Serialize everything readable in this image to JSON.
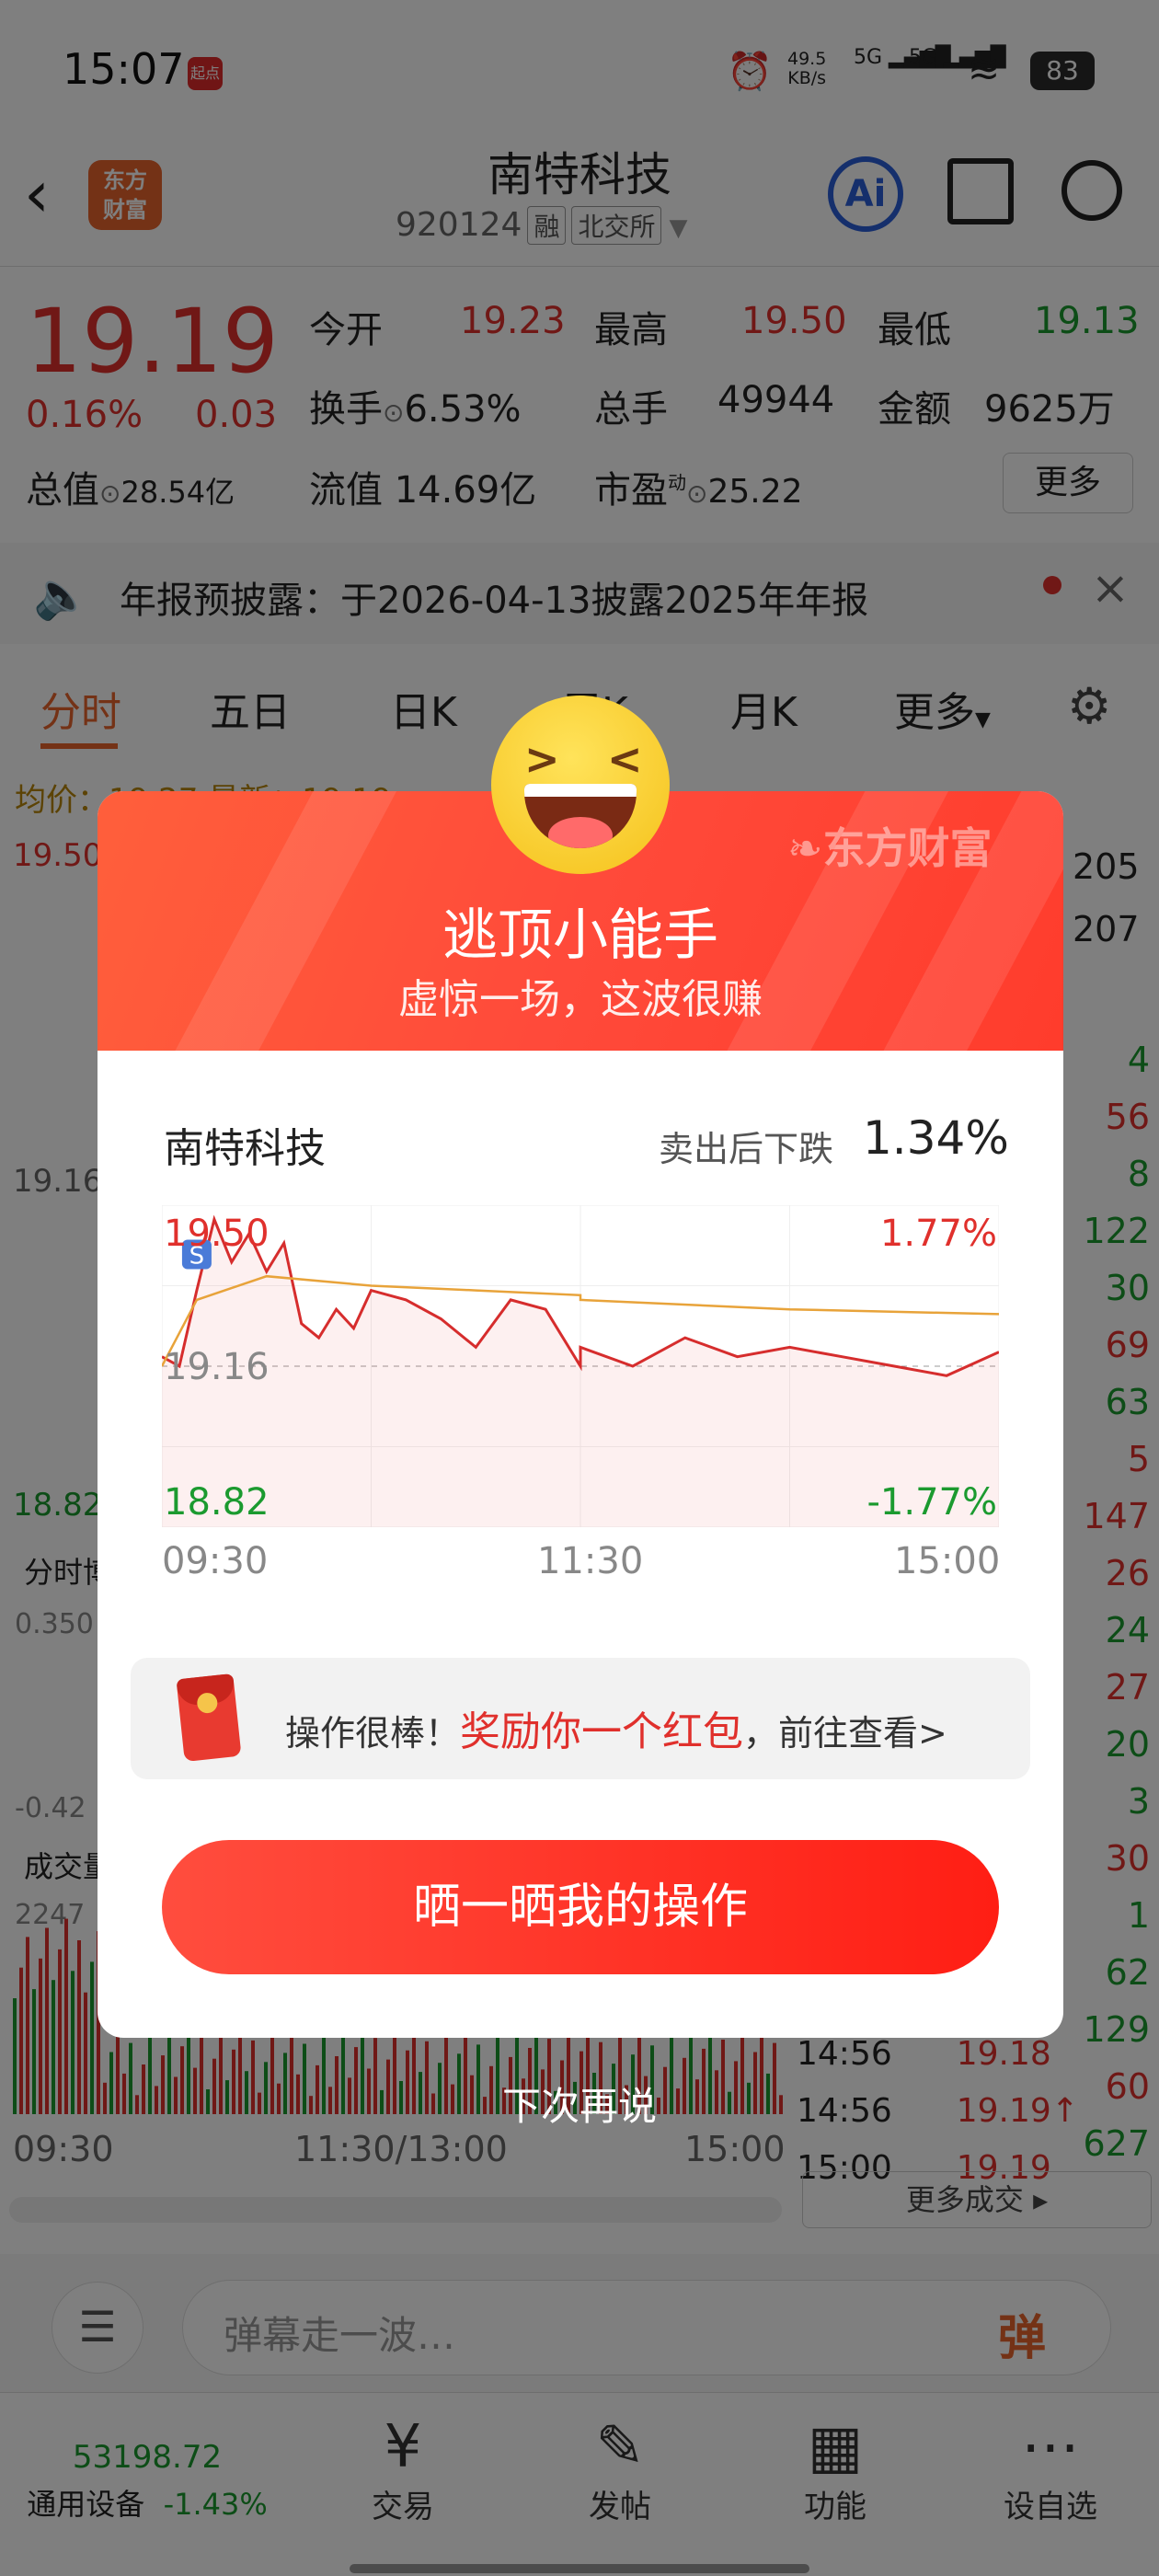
{
  "status_bar": {
    "time": "15:07",
    "badge": "起点",
    "net_speed_value": "49.5",
    "net_speed_unit": "KB/s",
    "sim1": "5G",
    "sim2": "5G",
    "battery": "83"
  },
  "header": {
    "logo_text_1": "东方",
    "logo_text_2": "财富",
    "stock_name": "南特科技",
    "stock_code": "920124",
    "tag_margin": "融",
    "tag_exchange": "北交所",
    "ai_label": "Ai"
  },
  "quote": {
    "price": "19.19",
    "change_pct": "0.16%",
    "change_amt": "0.03",
    "market_cap_label": "总值",
    "market_cap": "28.54亿",
    "open_label": "今开",
    "open": "19.23",
    "high_label": "最高",
    "high": "19.50",
    "low_label": "最低",
    "low": "19.13",
    "turnover_label": "换手",
    "turnover": "6.53%",
    "volume_label": "总手",
    "volume": "49944",
    "amount_label": "金额",
    "amount": "9625万",
    "float_cap_label": "流值",
    "float_cap": "14.69亿",
    "pe_label": "市盈",
    "pe_sup": "动",
    "pe": "25.22",
    "more_button": "更多"
  },
  "notice": {
    "text": "年报预披露：于2026-04-13披露2025年年报"
  },
  "tabs": [
    "分时",
    "五日",
    "日K",
    "周K",
    "月K",
    "更多"
  ],
  "chart_bg": {
    "avg_label": "均价：",
    "avg_value": "19.27",
    "latest_label": "最新：",
    "latest_value": "19.19",
    "y_top": "19.50",
    "y_mid": "19.16",
    "y_bottom": "18.82",
    "sub_label": "分时博",
    "sub_top": "0.350",
    "sub_bottom": "-0.42",
    "vol_label": "成交量",
    "vol_top": "2247",
    "x_start": "09:30",
    "x_mid": "11:30/13:00",
    "x_end": "15:00"
  },
  "right_panel": {
    "top_values": [
      "205",
      "207"
    ],
    "trade_volumes": [
      "4",
      "56",
      "8",
      "122",
      "30",
      "69",
      "63",
      "5",
      "147",
      "26",
      "24",
      "27",
      "20",
      "3",
      "30",
      "1",
      "62",
      "129",
      "60",
      "627"
    ],
    "rows": [
      {
        "time": "14:56",
        "price": "19.18",
        "vol": "129"
      },
      {
        "time": "14:56",
        "price": "19.19↑",
        "vol": "60"
      },
      {
        "time": "15:00",
        "price": "19.19",
        "vol": "627"
      }
    ],
    "more_trades": "更多成交"
  },
  "popup": {
    "brand": "东方财富",
    "title": "逃顶小能手",
    "subtitle": "虚惊一场，这波很赚",
    "stock_name": "南特科技",
    "drop_label": "卖出后下跌",
    "drop_value": "1.34%",
    "reward_prefix": "操作很棒！",
    "reward_highlight": "奖励你一个红包",
    "reward_suffix": "，前往查看>",
    "cta": "晒一晒我的操作",
    "dismiss": "下次再说"
  },
  "chart_data": {
    "type": "line",
    "x_labels": [
      "09:30",
      "11:30",
      "15:00"
    ],
    "ylim": [
      18.82,
      19.5
    ],
    "y_labels_left": [
      "19.50",
      "19.16",
      "18.82"
    ],
    "y_labels_right": [
      "1.77%",
      "-1.77%"
    ],
    "reference": 19.16,
    "sell_marker": {
      "label": "S",
      "x": "09:40",
      "y": 19.4
    },
    "series": [
      {
        "x": [
          "09:30",
          "09:35",
          "09:40",
          "09:45",
          "09:50",
          "09:55",
          "10:00",
          "10:05",
          "10:10",
          "10:15",
          "10:20",
          "10:25",
          "10:30",
          "10:40",
          "10:50",
          "11:00",
          "11:10",
          "11:20",
          "11:30",
          "13:00",
          "13:15",
          "13:30",
          "13:45",
          "14:00",
          "14:15",
          "14:30",
          "14:45",
          "15:00"
        ],
        "values": [
          19.18,
          19.16,
          19.32,
          19.47,
          19.38,
          19.44,
          19.36,
          19.42,
          19.25,
          19.22,
          19.28,
          19.24,
          19.32,
          19.3,
          19.26,
          19.2,
          19.3,
          19.28,
          19.16,
          19.2,
          19.16,
          19.22,
          19.18,
          19.2,
          19.18,
          19.16,
          19.14,
          19.19
        ]
      },
      {
        "x": [
          "09:30",
          "09:40",
          "10:00",
          "10:30",
          "11:00",
          "11:30",
          "13:00",
          "14:00",
          "15:00"
        ],
        "values": [
          19.16,
          19.3,
          19.35,
          19.33,
          19.32,
          19.31,
          19.3,
          19.28,
          19.27
        ]
      }
    ]
  },
  "comment_bar": {
    "placeholder": "弹幕走一波…",
    "danmu_button": "弹"
  },
  "bottom_nav": {
    "index_value": "53198.72",
    "index_name": "通用设备",
    "index_change": "-1.43%",
    "items": [
      "交易",
      "发帖",
      "功能",
      "设自选"
    ]
  }
}
